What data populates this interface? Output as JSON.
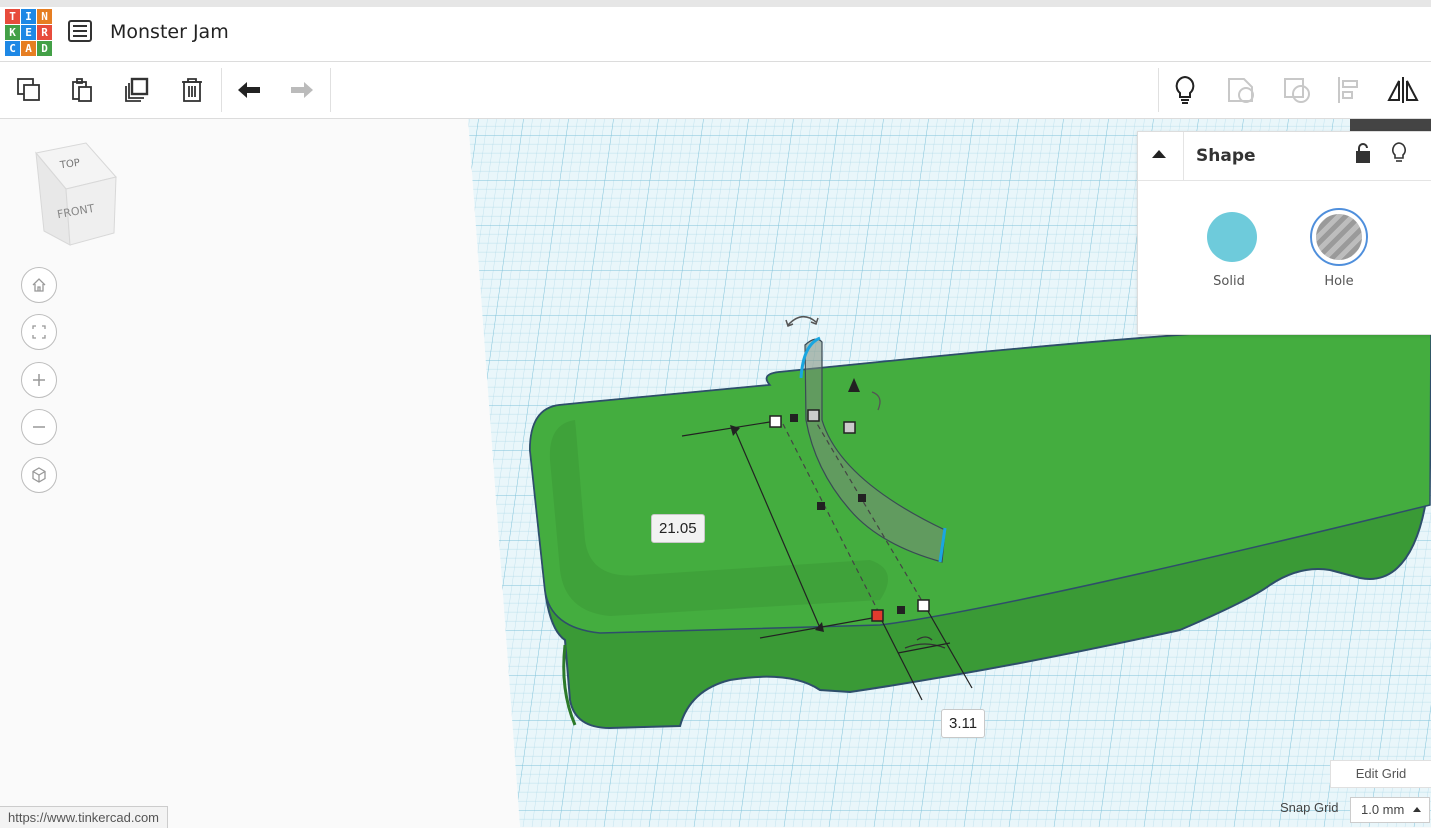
{
  "app": {
    "logo_letters": [
      "T",
      "I",
      "N",
      "K",
      "E",
      "R",
      "C",
      "A",
      "D"
    ],
    "logo_colors": [
      "#e74c3c",
      "#1e88e5",
      "#e67e22",
      "#43a047",
      "#1e88e5",
      "#e74c3c",
      "#1e88e5",
      "#e67e22",
      "#43a047"
    ],
    "project_title": "Monster Jam"
  },
  "toolbar": {
    "left_tools": [
      "copy-icon",
      "paste-icon",
      "duplicate-icon",
      "delete-icon",
      "undo-icon",
      "redo-icon"
    ],
    "right_tools": [
      "note-bulb-icon",
      "group-icon",
      "ungroup-icon",
      "align-icon",
      "mirror-icon"
    ]
  },
  "view_cube": {
    "top": "TOP",
    "front": "FRONT"
  },
  "nav_buttons": [
    "home-view-icon",
    "fit-view-icon",
    "zoom-in-icon",
    "zoom-out-icon",
    "ortho-view-icon"
  ],
  "shape_panel": {
    "title": "Shape",
    "solid_label": "Solid",
    "hole_label": "Hole",
    "solid_color": "#6ecbdb"
  },
  "dimensions": {
    "length": "21.05",
    "width": "3.11"
  },
  "grid": {
    "edit_label": "Edit Grid",
    "snap_label": "Snap Grid",
    "snap_value": "1.0 mm"
  },
  "status": {
    "url": "https://www.tinkercad.com"
  },
  "colors": {
    "model_green": "#3fa53b",
    "grid_blue": "#bfe3ee",
    "accent": "#4f8fdc"
  }
}
